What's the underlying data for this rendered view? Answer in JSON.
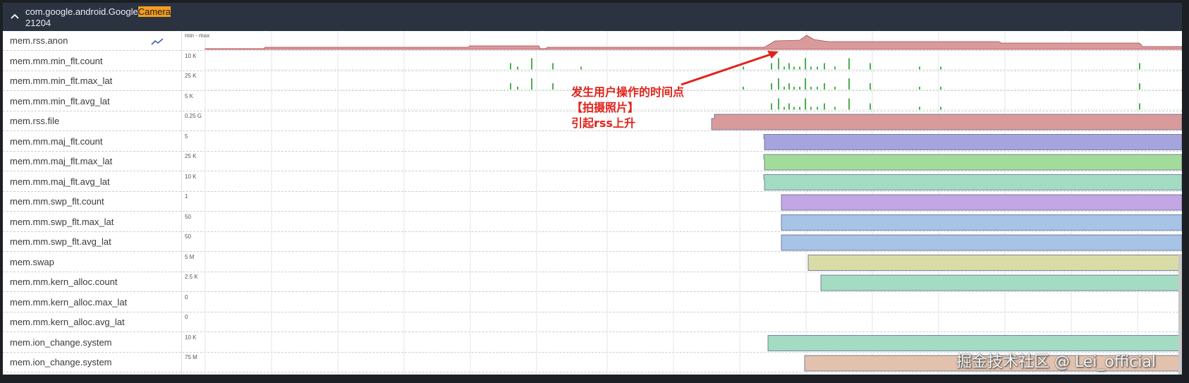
{
  "process": {
    "title_prefix": "com.google.android.Google",
    "title_highlight": "Camera",
    "pid": "21204"
  },
  "tracks": [
    {
      "label": "mem.rss.anon",
      "scale": "min - max",
      "kind": "area",
      "color": "#d99a9c"
    },
    {
      "label": "mem.mm.min_flt.count",
      "scale": "10 K",
      "kind": "spikes",
      "color": "#4caf50"
    },
    {
      "label": "mem.mm.min_flt.max_lat",
      "scale": "25 K",
      "kind": "spikes",
      "color": "#4caf50"
    },
    {
      "label": "mem.mm.min_flt.avg_lat",
      "scale": "5 K",
      "kind": "spikes",
      "color": "#4caf50"
    },
    {
      "label": "mem.rss.file",
      "scale": "0.25 G",
      "kind": "block",
      "color": "#d99a9c"
    },
    {
      "label": "mem.mm.maj_flt.count",
      "scale": "5",
      "kind": "block",
      "color": "#a6a4dc"
    },
    {
      "label": "mem.mm.maj_flt.max_lat",
      "scale": "25 K",
      "kind": "block",
      "color": "#a3dc9a"
    },
    {
      "label": "mem.mm.maj_flt.avg_lat",
      "scale": "10 K",
      "kind": "block",
      "color": "#a3dcc2"
    },
    {
      "label": "mem.mm.swp_flt.count",
      "scale": "1",
      "kind": "block",
      "color": "#c3a6e4"
    },
    {
      "label": "mem.mm.swp_flt.max_lat",
      "scale": "50",
      "kind": "block",
      "color": "#a7c3e6"
    },
    {
      "label": "mem.mm.swp_flt.avg_lat",
      "scale": "50",
      "kind": "block",
      "color": "#a7c3e6"
    },
    {
      "label": "mem.swap",
      "scale": "5 M",
      "kind": "block",
      "color": "#d9dca6"
    },
    {
      "label": "mem.mm.kern_alloc.count",
      "scale": "2.5 K",
      "kind": "block",
      "color": "#a3dcc2"
    },
    {
      "label": "mem.mm.kern_alloc.max_lat",
      "scale": "0",
      "kind": "empty",
      "color": "#cccccc"
    },
    {
      "label": "mem.mm.kern_alloc.avg_lat",
      "scale": "0",
      "kind": "empty",
      "color": "#cccccc"
    },
    {
      "label": "mem.ion_change.system",
      "scale": "10 K",
      "kind": "block",
      "color": "#a3dcc2"
    },
    {
      "label": "mem.ion_change.system",
      "scale": "75 M",
      "kind": "block",
      "color": "#e3c2ad"
    }
  ],
  "annotation": {
    "line1": "发生用户操作的时间点",
    "line2": "【拍摄照片】",
    "line3": "引起rss上升",
    "color": "#e1231b"
  },
  "watermark": "掘金技术社区 @ Lei_official",
  "icons": {
    "collapse": "chevron-up-icon",
    "trend": "trend-line-icon"
  }
}
